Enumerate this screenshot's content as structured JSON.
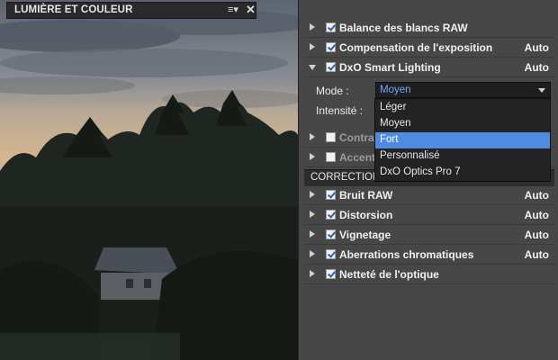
{
  "panel": {
    "title": "LUMIÈRE ET COULEUR",
    "menu_glyph": "≡▾",
    "close_glyph": "✕"
  },
  "rows_top": [
    {
      "label": "Balance des blancs RAW",
      "checked": true,
      "auto": ""
    },
    {
      "label": "Compensation de l'exposition",
      "checked": true,
      "auto": "Auto"
    },
    {
      "label": "DxO Smart Lighting",
      "checked": true,
      "auto": "Auto",
      "expanded": true
    }
  ],
  "smart_lighting": {
    "mode_label": "Mode :",
    "intensity_label": "Intensité :",
    "mode_value": "Moyen",
    "options": [
      "Léger",
      "Moyen",
      "Fort",
      "Personnalisé",
      "DxO Optics Pro 7"
    ],
    "highlighted": "Fort"
  },
  "rows_hidden": [
    {
      "label": "Contras",
      "checked": false
    },
    {
      "label": "Accentu",
      "checked": false
    }
  ],
  "section2": {
    "title": "CORRECTIONS"
  },
  "rows_bottom": [
    {
      "label": "Bruit RAW",
      "checked": true,
      "auto": "Auto"
    },
    {
      "label": "Distorsion",
      "checked": true,
      "auto": "Auto"
    },
    {
      "label": "Vignetage",
      "checked": true,
      "auto": "Auto"
    },
    {
      "label": "Aberrations chromatiques",
      "checked": true,
      "auto": "Auto"
    },
    {
      "label": "Netteté de l'optique",
      "checked": true,
      "auto": ""
    }
  ],
  "colors": {
    "panel_bg": "#474747",
    "header_bg": "#2a2a2a",
    "highlight": "#4f8be0",
    "select_text": "#6fa8ff"
  }
}
